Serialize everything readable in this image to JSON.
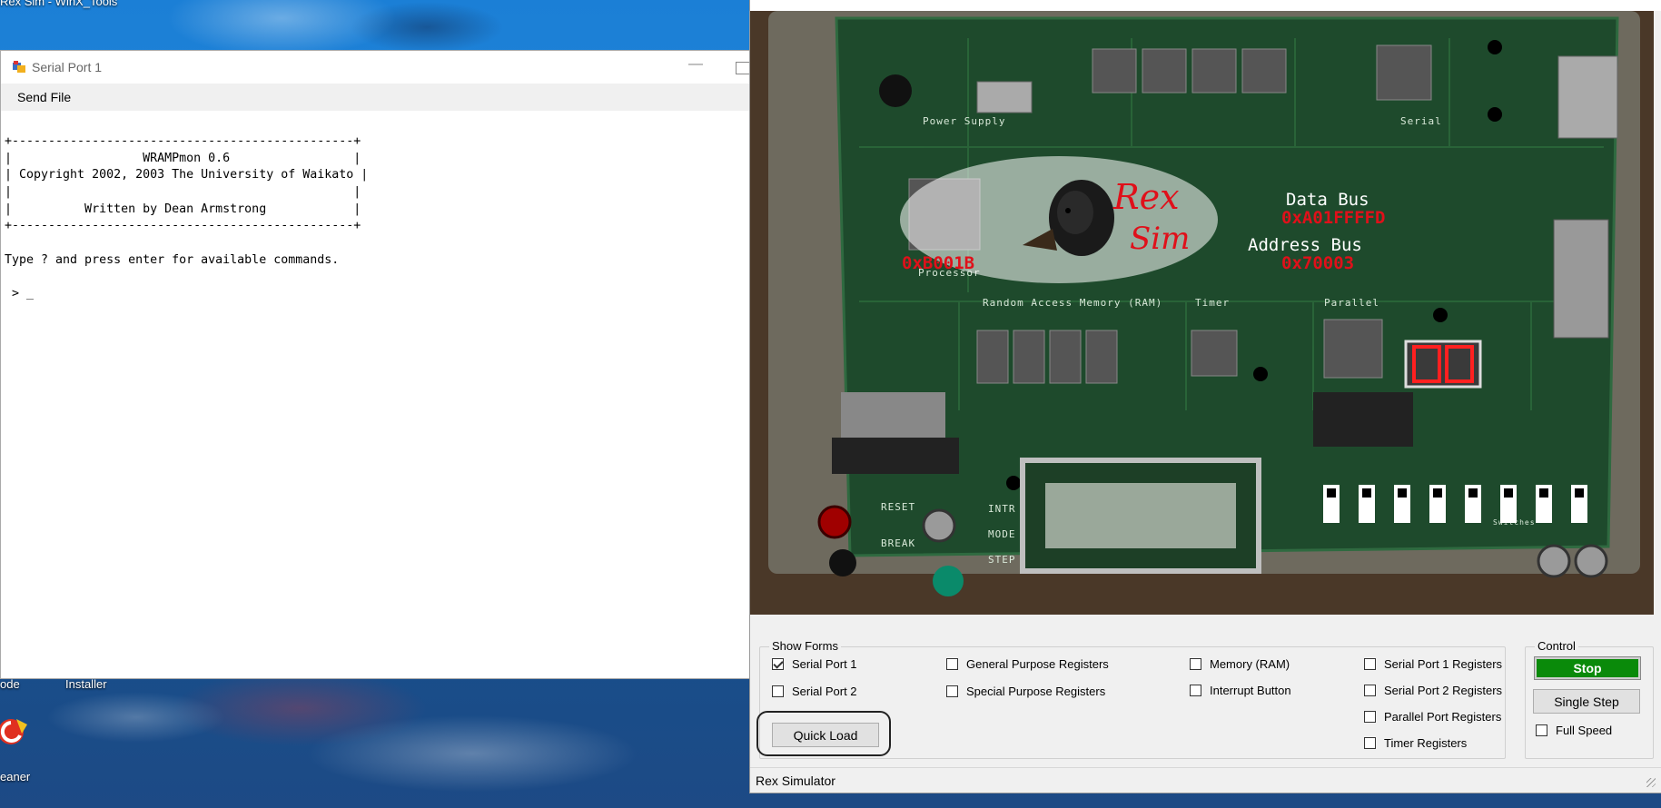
{
  "desktop": {
    "top_text": "Rex Sim - WinX_Tools",
    "icon_label_left": "ode",
    "icon_label_installer": "Installer",
    "icon_label_cleaner": "eaner"
  },
  "serial_window": {
    "title": "Serial Port 1",
    "menu": [
      "Send File"
    ],
    "terminal_lines": [
      "+-----------------------------------------------+",
      "|                  WRAMPmon 0.6                 |",
      "| Copyright 2002, 2003 The University of Waikato |",
      "|                                               |",
      "|          Written by Dean Armstrong            |",
      "+-----------------------------------------------+",
      "",
      "Type ? and press enter for available commands.",
      "",
      " > _"
    ]
  },
  "rex_window": {
    "board": {
      "logo_line1": "Rex",
      "logo_line2": "Sim",
      "data_bus_label": "Data Bus",
      "data_bus_value": "0xA01FFFFD",
      "address_bus_label": "Address Bus",
      "address_bus_value": "0x70003",
      "processor_value": "0xB001B",
      "silkscreen": {
        "power_supply": "Power Supply",
        "processor": "Processor",
        "ram": "Random Access Memory (RAM)",
        "timer": "Timer",
        "parallel": "Parallel",
        "serial": "Serial",
        "reset": "RESET",
        "break": "BREAK",
        "intr": "INTR",
        "mode": "MODE",
        "step": "STEP",
        "switches": "Switches"
      },
      "seven_segment_count": 2,
      "switch_count": 8
    },
    "show_forms": {
      "label": "Show Forms",
      "checkboxes": [
        {
          "label": "Serial Port 1",
          "checked": true
        },
        {
          "label": "Serial Port 2",
          "checked": false
        },
        {
          "label": "General Purpose Registers",
          "checked": false
        },
        {
          "label": "Special Purpose Registers",
          "checked": false
        },
        {
          "label": "Memory (RAM)",
          "checked": false
        },
        {
          "label": "Interrupt Button",
          "checked": false
        },
        {
          "label": "Serial Port 1 Registers",
          "checked": false
        },
        {
          "label": "Serial Port 2 Registers",
          "checked": false
        },
        {
          "label": "Parallel Port Registers",
          "checked": false
        },
        {
          "label": "Timer Registers",
          "checked": false
        }
      ],
      "quick_load": "Quick Load"
    },
    "control": {
      "label": "Control",
      "stop": "Stop",
      "single_step": "Single Step",
      "full_speed": "Full Speed",
      "full_speed_checked": false
    },
    "status": "Rex Simulator"
  },
  "colors": {
    "stop_button": "#0a8a0a",
    "board_pcb": "#1f4a2a",
    "board_overlay_text": "#e0101a"
  }
}
